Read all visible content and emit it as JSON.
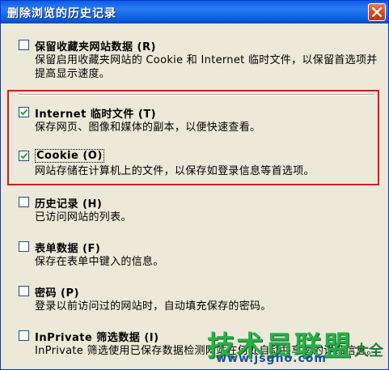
{
  "window": {
    "title": "删除浏览的历史记录"
  },
  "options": [
    {
      "title": "保留收藏夹网站数据 (R)",
      "checked": false,
      "desc": "保留启用收藏夹网站的 Cookie 和 Internet 临时文件，以保留首选项并提高显示速度。"
    },
    {
      "title": "Internet 临时文件 (T)",
      "checked": true,
      "desc": "保存网页、图像和媒体的副本，以便快速查看。"
    },
    {
      "title": "Cookie (O)",
      "checked": true,
      "desc": "网站存储在计算机上的文件，以保存如登录信息等首选项。"
    },
    {
      "title": "历史记录 (H)",
      "checked": false,
      "desc": "已访问网站的列表。"
    },
    {
      "title": "表单数据 (F)",
      "checked": false,
      "desc": "保存在表单中键入的信息。"
    },
    {
      "title": "密码 (P)",
      "checked": false,
      "desc": "登录以前访问过的网站时，自动填充保存的密码。"
    },
    {
      "title": "InPrivate 筛选数据 (I)",
      "checked": false,
      "desc": "InPrivate 筛选使用已保存数据检测网站在何处自动共享您的详细信息。"
    }
  ],
  "watermark": {
    "main": "技术员联盟",
    "side": "大全",
    "url": "www.jsgho.com"
  },
  "colors": {
    "titlebar": "#0a5ee0",
    "highlight_border": "#e1141c",
    "watermark": "#26b04a"
  }
}
